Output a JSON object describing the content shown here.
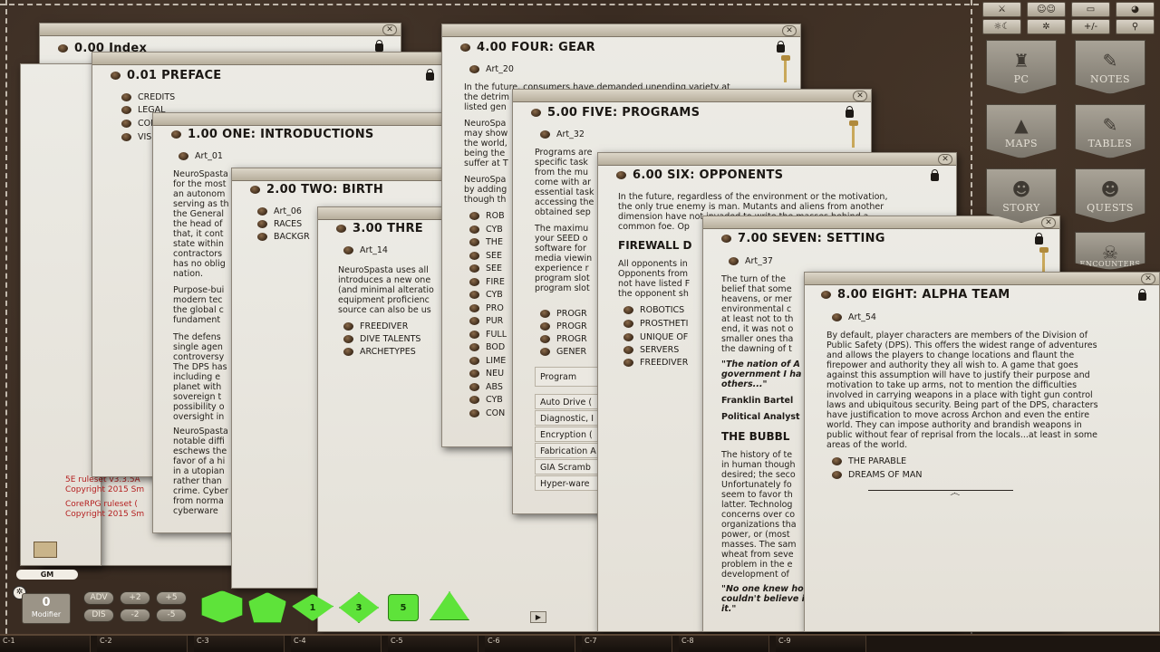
{
  "index_window": {
    "title": "0.00 Index",
    "footer_lines": [
      {
        "line1": "5E ruleset v3.3.5A",
        "line2": "Copyright 2015 Sm"
      },
      {
        "line1": "CoreRPG ruleset (",
        "line2": "Copyright 2015 Sm"
      }
    ]
  },
  "preface_window": {
    "title": "0.01 PREFACE",
    "items": [
      "CREDITS",
      "LEGAL",
      "CON",
      "VIS"
    ]
  },
  "intro_window": {
    "title": "1.00 ONE: INTRODUCTIONS",
    "art": "Art_01",
    "paragraphs": [
      "NeuroSpasta\nfor the most\nan autonom\nserving as th\nthe General\nthe head of\nthat, it cont\nstate within\ncontractors\nhas no oblig\nnation.",
      "Purpose-bui\nmodern tec\nthe global c\nfundament",
      "The defens\nsingle agen\ncontroversy\nThe DPS has\nincluding e\nplanet with\nsovereign t\npossibility o\noversight in",
      "NeuroSpasta\nnotable diffi\neschews the\nfavor of a hi\nin a utopian\nrather than\ncrime. Cyber\nfrom norma\ncyberware"
    ]
  },
  "birth_window": {
    "title": "2.00 TWO: BIRTH",
    "art": "Art_06",
    "items": [
      "RACES",
      "BACKGR"
    ]
  },
  "three_window": {
    "title": "3.00 THRE",
    "art": "Art_14",
    "body": "NeuroSpasta uses all\nintroduces a new one\n(and minimal alteratio\nequipment proficienc\nsource can also be us",
    "items": [
      "FREEDIVER",
      "DIVE TALENTS",
      "ARCHETYPES"
    ]
  },
  "gear_window": {
    "title": "4.00 FOUR: GEAR",
    "art": "Art_20",
    "body1": "In the future, consumers have demanded unending variety at\nthe detrim\nlisted gen",
    "body2": "NeuroSpa\nmay show\nthe world,\nbeing the\nsuffer at T",
    "body3": "NeuroSpa\nby adding\nthough th",
    "items": [
      "ROB",
      "CYB",
      "THE",
      "SEE",
      "SEE",
      "FIRE",
      "CYB",
      "PRO",
      "PUR",
      "FULL",
      "BOD",
      "LIME",
      "NEU",
      "ABS",
      "CYB",
      "CON"
    ]
  },
  "programs_window": {
    "title": "5.00 FIVE: PROGRAMS",
    "art": "Art_32",
    "body1": "Programs are\nspecific task\nfrom the mu\ncome with ar\nessential task\naccessing the\nobtained sep",
    "body2": "The maximu\nyour SEED o\nsoftware for\nmedia viewin\nexperience r\nprogram slot\nprogram slot",
    "items": [
      "PROGR",
      "PROGR",
      "PROGR",
      "GENER"
    ],
    "table_header": "Program",
    "table_rows": [
      "Auto Drive (",
      "Diagnostic, I",
      "Encryption (",
      "Fabrication A",
      "GIA Scramb",
      "Hyper-ware"
    ]
  },
  "opponents_window": {
    "title": "6.00 SIX: OPPONENTS",
    "body1": "In the future, regardless of the environment or the motivation,\nthe only true enemy is man. Mutants and aliens from another\ndimension have not invaded to write the masses behind a\ncommon foe. Op",
    "subheading": "FIREWALL D",
    "body2": "All opponents in\nOpponents from\nnot have listed F\nthe opponent sh",
    "items": [
      "ROBOTICS",
      "PROSTHETI",
      "UNIQUE OF",
      "SERVERS",
      "FREEDIVER"
    ]
  },
  "setting_window": {
    "title": "7.00 SEVEN: SETTING",
    "art": "Art_37",
    "body1": "The turn of the\nbelief that some\nheavens, or mer\nenvironmental c\nat least not to th\nend, it was not o\nsmaller ones tha\nthe dawning of t",
    "quote1": "\"The nation of A\ngovernment I ha\nothers...\"",
    "attr_name": "Franklin Bartel",
    "attr_role": "Political Analyst",
    "subheading": "THE BUBBL",
    "body2": "The history of te\nin human though\ndesired; the seco\nUnfortunately fo\nseem to favor th\nlatter. Technolog\nconcerns over co\norganizations tha\npower, or (most\nmasses. The sam\nwheat from seve\nproblem in the e\ndevelopment of",
    "quote2": "\"No one knew ho\ncouldn't believe i\nit.\""
  },
  "alpha_window": {
    "title": "8.00 EIGHT: ALPHA TEAM",
    "art": "Art_54",
    "body": "By default, player characters are members of the Division of\nPublic Safety (DPS). This offers the widest range of adventures\nand allows the players to change locations and flaunt the\nfirepower and authority they all wish to. A game that goes\nagainst this assumption will have to justify their purpose and\nmotivation to take up arms, not to mention the difficulties\ninvolved in carrying weapons in a place with tight gun control\nlaws and ubiquitous security. Being part of the DPS, characters\nhave justification to move across Archon and even the entire\nworld. They can impose authority and brandish weapons in\npublic without fear of reprisal from the locals...at least in some\nareas of the world.",
    "items": [
      "THE PARABLE",
      "DREAMS OF MAN"
    ]
  },
  "sidebar": {
    "tool_buttons_row1": [
      {
        "icon": "swords-icon",
        "glyph": "⚔"
      },
      {
        "icon": "party-icon",
        "glyph": "☺☺"
      },
      {
        "icon": "map-pin-icon",
        "glyph": "▭"
      },
      {
        "icon": "palette-icon",
        "glyph": "◕"
      }
    ],
    "tool_buttons_row2": [
      {
        "icon": "day-night-icon",
        "glyph": "☼☾"
      },
      {
        "icon": "settings-icon",
        "glyph": "✲"
      },
      {
        "label": "+/-"
      },
      {
        "icon": "walk-icon",
        "glyph": "⚲"
      }
    ],
    "banners": [
      {
        "label": "PC",
        "glyph": "♜"
      },
      {
        "label": "NOTES",
        "glyph": "✎"
      },
      {
        "label": "MAPS",
        "glyph": "▲"
      },
      {
        "label": "TABLES",
        "glyph": "✎"
      },
      {
        "label": "STORY",
        "glyph": "☻"
      },
      {
        "label": "QUESTS",
        "glyph": "☻"
      },
      {
        "label": "",
        "glyph": "☠"
      }
    ],
    "partial_banner_label": "ENCOUNTERS"
  },
  "dice_tray": {
    "gm_label": "GM",
    "modifier_value": "0",
    "modifier_label": "Modifier",
    "buttons": [
      "ADV",
      "+2",
      "+5",
      "DIS",
      "-2",
      "-5"
    ],
    "dice": [
      "d20",
      "d12",
      "d10",
      "d8",
      "d6",
      "d4"
    ],
    "dice_faces": [
      "",
      "",
      "1",
      "3",
      "5",
      ""
    ],
    "dice_color": "#5ee33a"
  },
  "hotkeys": [
    "C-1",
    "C-2",
    "C-3",
    "C-4",
    "C-5",
    "C-6",
    "C-7",
    "C-8",
    "C-9"
  ]
}
